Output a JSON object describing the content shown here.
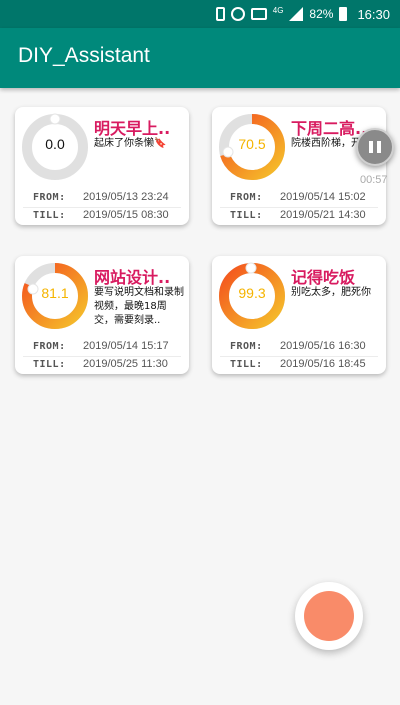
{
  "statusbar": {
    "network": "4G",
    "battery": "82%",
    "time": "16:30"
  },
  "appbar": {
    "title": "DIY_Assistant"
  },
  "cards": [
    {
      "title": "明天早上..",
      "desc": "起床了你条懒🔖",
      "progress": "0.0",
      "from_label": "FROM:",
      "from": "2019/05/13 23:24",
      "till_label": "TILL:",
      "till": "2019/05/15 08:30"
    },
    {
      "title": "下周二高..",
      "desc": "院楼西阶梯，开挂考",
      "progress": "70.5",
      "from_label": "FROM:",
      "from": "2019/05/14 15:02",
      "till_label": "TILL:",
      "till": "2019/05/21 14:30"
    },
    {
      "title": "网站设计..",
      "desc": "要写说明文档和录制视频，最晚18周交，需要刻录..",
      "progress": "81.1",
      "from_label": "FROM:",
      "from": "2019/05/14 15:17",
      "till_label": "TILL:",
      "till": "2019/05/25 11:30"
    },
    {
      "title": "记得吃饭",
      "desc": "别吃太多，肥死你",
      "progress": "99.3",
      "from_label": "FROM:",
      "from": "2019/05/16 16:30",
      "till_label": "TILL:",
      "till": "2019/05/16 18:45"
    }
  ],
  "floating_timer": {
    "time": "00:57"
  },
  "colors": {
    "appbar": "#00897b",
    "statusbar": "#00766a",
    "title": "#d81b60",
    "progress_start": "#f5c22b",
    "progress_end": "#f4511e",
    "track": "#e0e0e0",
    "fab": "#f98b69"
  }
}
